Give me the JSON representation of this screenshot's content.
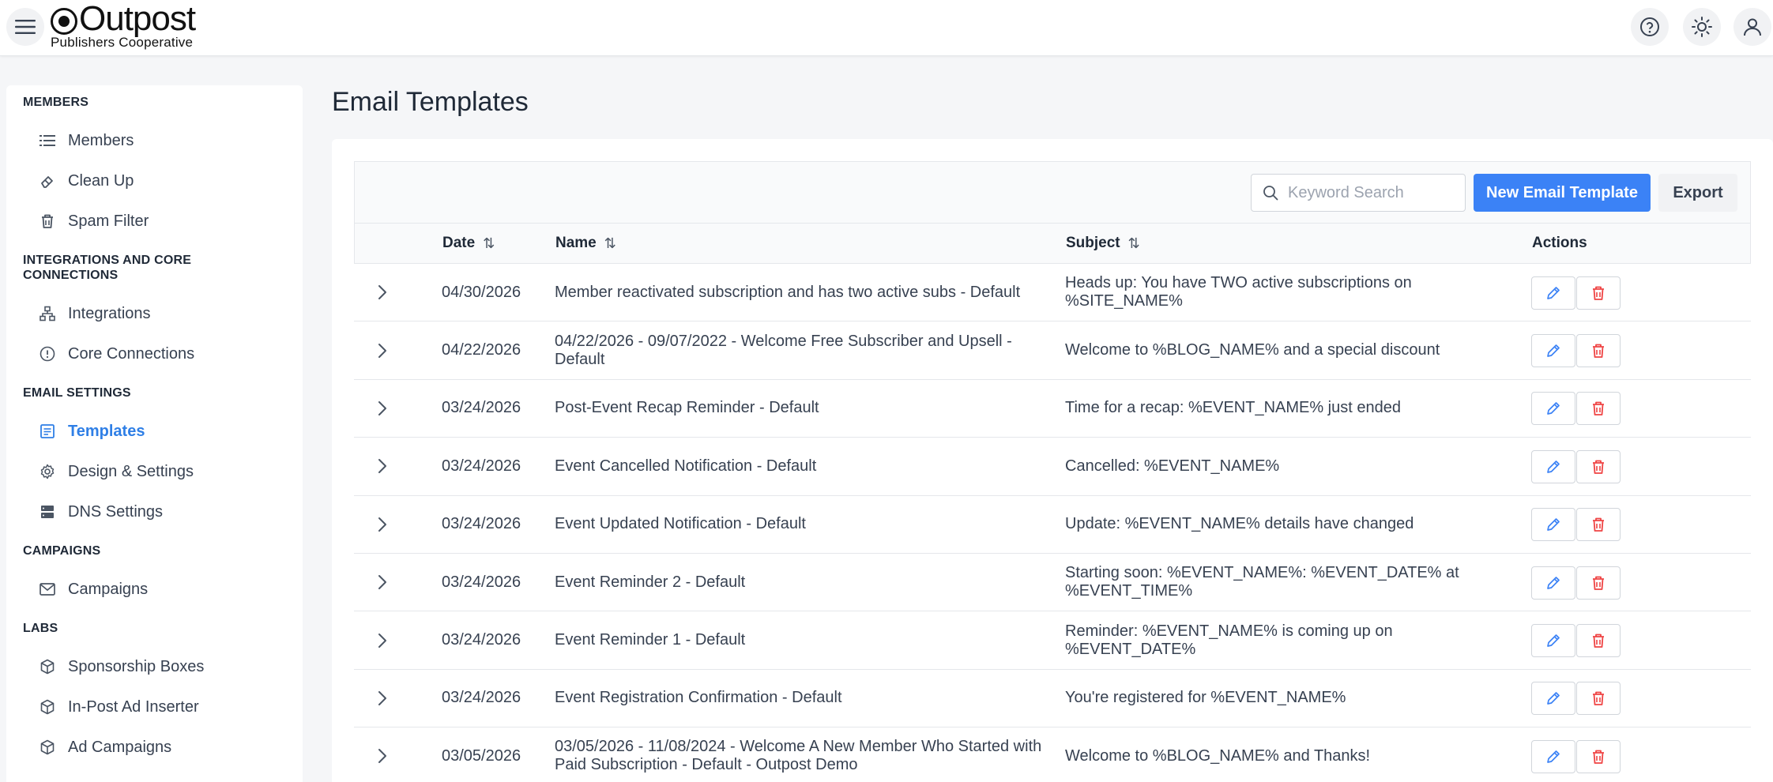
{
  "header": {
    "brand_title": "Outpost",
    "brand_subtitle": "Publishers Cooperative"
  },
  "sidebar": {
    "sections": [
      {
        "title": "MEMBERS",
        "items": [
          {
            "label": "Members",
            "icon": "list-icon"
          },
          {
            "label": "Clean Up",
            "icon": "eraser-icon"
          },
          {
            "label": "Spam Filter",
            "icon": "trash-icon"
          }
        ]
      },
      {
        "title": "INTEGRATIONS AND CORE CONNECTIONS",
        "items": [
          {
            "label": "Integrations",
            "icon": "network-icon"
          },
          {
            "label": "Core Connections",
            "icon": "info-circle-icon"
          }
        ]
      },
      {
        "title": "EMAIL SETTINGS",
        "items": [
          {
            "label": "Templates",
            "icon": "template-icon",
            "active": true
          },
          {
            "label": "Design & Settings",
            "icon": "gear-icon"
          },
          {
            "label": "DNS Settings",
            "icon": "server-icon"
          }
        ]
      },
      {
        "title": "CAMPAIGNS",
        "items": [
          {
            "label": "Campaigns",
            "icon": "mail-icon"
          }
        ]
      },
      {
        "title": "LABS",
        "items": [
          {
            "label": "Sponsorship Boxes",
            "icon": "box-icon"
          },
          {
            "label": "In-Post Ad Inserter",
            "icon": "box-icon"
          },
          {
            "label": "Ad Campaigns",
            "icon": "box-icon"
          }
        ]
      }
    ]
  },
  "main": {
    "title": "Email Templates",
    "search_placeholder": "Keyword Search",
    "new_button": "New Email Template",
    "export_button": "Export",
    "columns": {
      "date": "Date",
      "name": "Name",
      "subject": "Subject",
      "actions": "Actions"
    },
    "rows": [
      {
        "date": "04/30/2026",
        "name": "Member reactivated subscription and has two active subs - Default",
        "subject": "Heads up: You have TWO active subscriptions on %SITE_NAME%"
      },
      {
        "date": "04/22/2026",
        "name": "04/22/2026 - 09/07/2022 - Welcome Free Subscriber and Upsell - Default",
        "subject": "Welcome to %BLOG_NAME% and a special discount"
      },
      {
        "date": "03/24/2026",
        "name": "Post-Event Recap Reminder - Default",
        "subject": "Time for a recap: %EVENT_NAME% just ended"
      },
      {
        "date": "03/24/2026",
        "name": "Event Cancelled Notification - Default",
        "subject": "Cancelled: %EVENT_NAME%"
      },
      {
        "date": "03/24/2026",
        "name": "Event Updated Notification - Default",
        "subject": "Update: %EVENT_NAME% details have changed"
      },
      {
        "date": "03/24/2026",
        "name": "Event Reminder 2 - Default",
        "subject": "Starting soon: %EVENT_NAME%: %EVENT_DATE% at %EVENT_TIME%"
      },
      {
        "date": "03/24/2026",
        "name": "Event Reminder 1 - Default",
        "subject": "Reminder: %EVENT_NAME% is coming up on %EVENT_DATE%"
      },
      {
        "date": "03/24/2026",
        "name": "Event Registration Confirmation - Default",
        "subject": "You're registered for %EVENT_NAME%"
      },
      {
        "date": "03/05/2026",
        "name": "03/05/2026 - 11/08/2024 - Welcome A New Member Who Started with Paid Subscription - Default - Outpost Demo",
        "subject": "Welcome to %BLOG_NAME% and Thanks!"
      }
    ]
  },
  "colors": {
    "accent": "#3b82f6",
    "active_nav": "#2f7fe6",
    "danger": "#ef4444"
  }
}
